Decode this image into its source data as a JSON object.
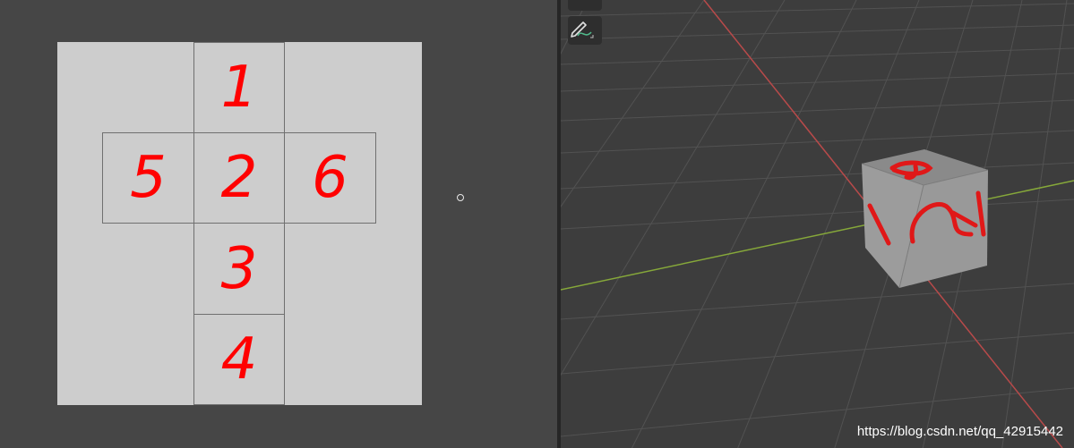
{
  "uv_editor": {
    "faces": [
      {
        "id": "face-1",
        "label": "1"
      },
      {
        "id": "face-2",
        "label": "2"
      },
      {
        "id": "face-3",
        "label": "3"
      },
      {
        "id": "face-4",
        "label": "4"
      },
      {
        "id": "face-5",
        "label": "5"
      },
      {
        "id": "face-6",
        "label": "6"
      }
    ]
  },
  "viewport": {
    "tools": [
      {
        "icon": "tool-icon"
      },
      {
        "icon": "annotate-pencil-icon"
      }
    ]
  },
  "colors": {
    "uv_background": "#cdcdcd",
    "editor_background": "#464646",
    "viewport_background": "#3d3d3d",
    "x_axis": "#b84a4a",
    "y_axis": "#86a83a",
    "label_color": "#ff0000"
  },
  "watermark": "https://blog.csdn.net/qq_42915442"
}
